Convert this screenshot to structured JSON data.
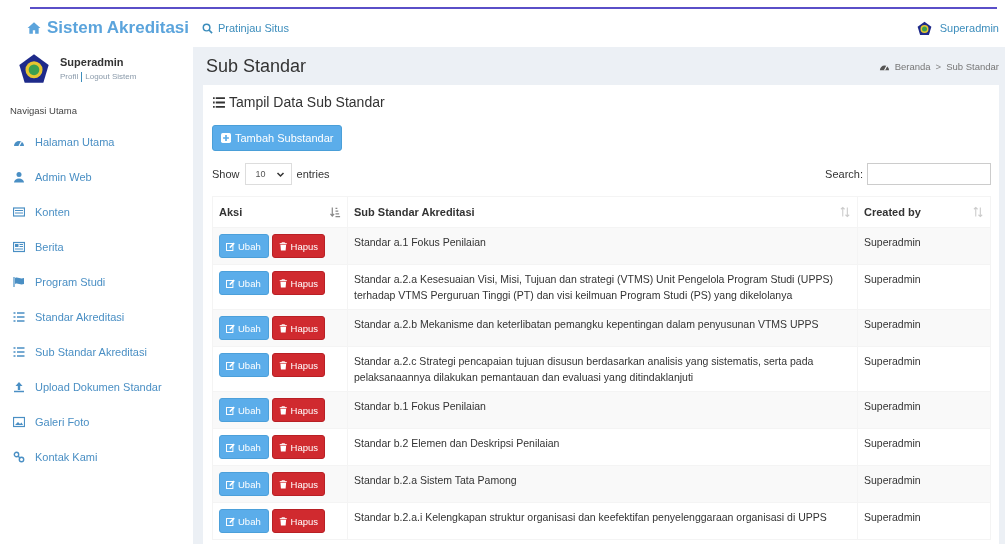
{
  "header": {
    "brand": "Sistem Akreditasi",
    "preview_link": "Pratinjau Situs",
    "user": "Superadmin"
  },
  "sidebar": {
    "user": {
      "name": "Superadmin",
      "links": [
        "Profil",
        "Logout Sistem"
      ]
    },
    "nav_header": "Navigasi Utama",
    "items": [
      {
        "label": "Halaman Utama",
        "kind": "dashboard"
      },
      {
        "label": "Admin Web",
        "kind": "user"
      },
      {
        "label": "Konten",
        "kind": "card"
      },
      {
        "label": "Berita",
        "kind": "news"
      },
      {
        "label": "Program Studi",
        "kind": "flag"
      },
      {
        "label": "Standar Akreditasi",
        "kind": "list"
      },
      {
        "label": "Sub Standar Akreditasi",
        "kind": "list"
      },
      {
        "label": "Upload Dokumen Standar",
        "kind": "upload"
      },
      {
        "label": "Galeri Foto",
        "kind": "image"
      },
      {
        "label": "Kontak Kami",
        "kind": "link"
      }
    ]
  },
  "page": {
    "title": "Sub Standar",
    "breadcrumb": [
      "Beranda",
      "Sub Standar"
    ],
    "breadcrumb_separator": ">"
  },
  "box": {
    "title": "Tampil Data Sub Standar",
    "add_button": "Tambah Substandar",
    "length": {
      "show": "Show",
      "value": "10",
      "entries": "entries"
    },
    "search_label": "Search:",
    "table": {
      "columns": [
        {
          "label": "Aksi",
          "sorted": true
        },
        {
          "label": "Sub Standar Akreditasi",
          "sorted": false
        },
        {
          "label": "Created by",
          "sorted": false
        }
      ],
      "rows": [
        {
          "actions": [
            "Ubah",
            "Hapus"
          ],
          "sub_standar": "Standar a.1 Fokus Penilaian",
          "created_by": "Superadmin"
        },
        {
          "actions": [
            "Ubah",
            "Hapus"
          ],
          "sub_standar": "Standar a.2.a Kesesuaian Visi, Misi, Tujuan dan strategi (VTMS) Unit Pengelola Program Studi (UPPS) terhadap VTMS Perguruan Tinggi (PT) dan visi keilmuan Program Studi (PS) yang dikelolanya",
          "created_by": "Superadmin"
        },
        {
          "actions": [
            "Ubah",
            "Hapus"
          ],
          "sub_standar": "Standar a.2.b Mekanisme dan keterlibatan pemangku kepentingan dalam penyusunan VTMS UPPS",
          "created_by": "Superadmin"
        },
        {
          "actions": [
            "Ubah",
            "Hapus"
          ],
          "sub_standar": "Standar a.2.c Strategi pencapaian tujuan disusun berdasarkan analisis yang sistematis, serta pada pelaksanaannya dilakukan pemantauan dan evaluasi yang ditindaklanjuti",
          "created_by": "Superadmin"
        },
        {
          "actions": [
            "Ubah",
            "Hapus"
          ],
          "sub_standar": "Standar b.1 Fokus Penilaian",
          "created_by": "Superadmin"
        },
        {
          "actions": [
            "Ubah",
            "Hapus"
          ],
          "sub_standar": "Standar b.2 Elemen dan Deskripsi Penilaian",
          "created_by": "Superadmin"
        },
        {
          "actions": [
            "Ubah",
            "Hapus"
          ],
          "sub_standar": "Standar b.2.a Sistem Tata Pamong",
          "created_by": "Superadmin"
        },
        {
          "actions": [
            "Ubah",
            "Hapus"
          ],
          "sub_standar": "Standar b.2.a.i Kelengkapan struktur organisasi dan keefektifan penyelenggaraan organisasi di UPPS",
          "created_by": "Superadmin"
        }
      ]
    }
  }
}
